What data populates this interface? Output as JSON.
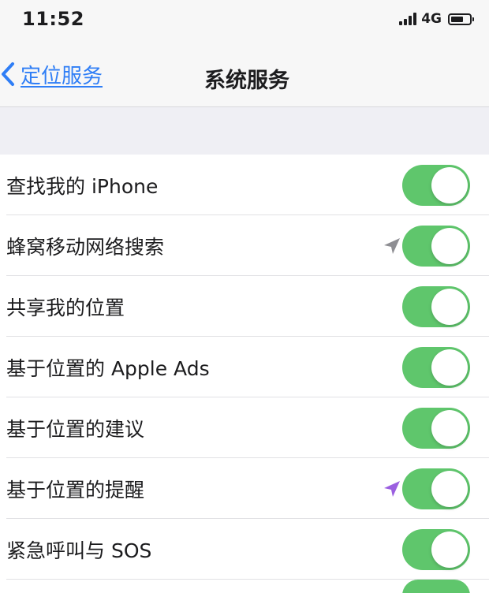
{
  "status_bar": {
    "time": "11:52",
    "network": "4G",
    "battery_level": 0.7
  },
  "nav": {
    "back_label": "定位服务",
    "title": "系统服务"
  },
  "colors": {
    "accent": "#2f7ef6",
    "toggle_on": "#5fc66c",
    "arrow_gray": "#8e8e93",
    "arrow_purple": "#9b5fe0"
  },
  "rows": [
    {
      "label": "查找我的 iPhone",
      "enabled": true,
      "indicator": "none"
    },
    {
      "label": "蜂窝移动网络搜索",
      "enabled": true,
      "indicator": "location-arrow-gray-icon"
    },
    {
      "label": "共享我的位置",
      "enabled": true,
      "indicator": "none"
    },
    {
      "label": "基于位置的 Apple Ads",
      "enabled": true,
      "indicator": "none"
    },
    {
      "label": "基于位置的建议",
      "enabled": true,
      "indicator": "none"
    },
    {
      "label": "基于位置的提醒",
      "enabled": true,
      "indicator": "location-arrow-purple-icon"
    },
    {
      "label": "紧急呼叫与 SOS",
      "enabled": true,
      "indicator": "none"
    }
  ]
}
